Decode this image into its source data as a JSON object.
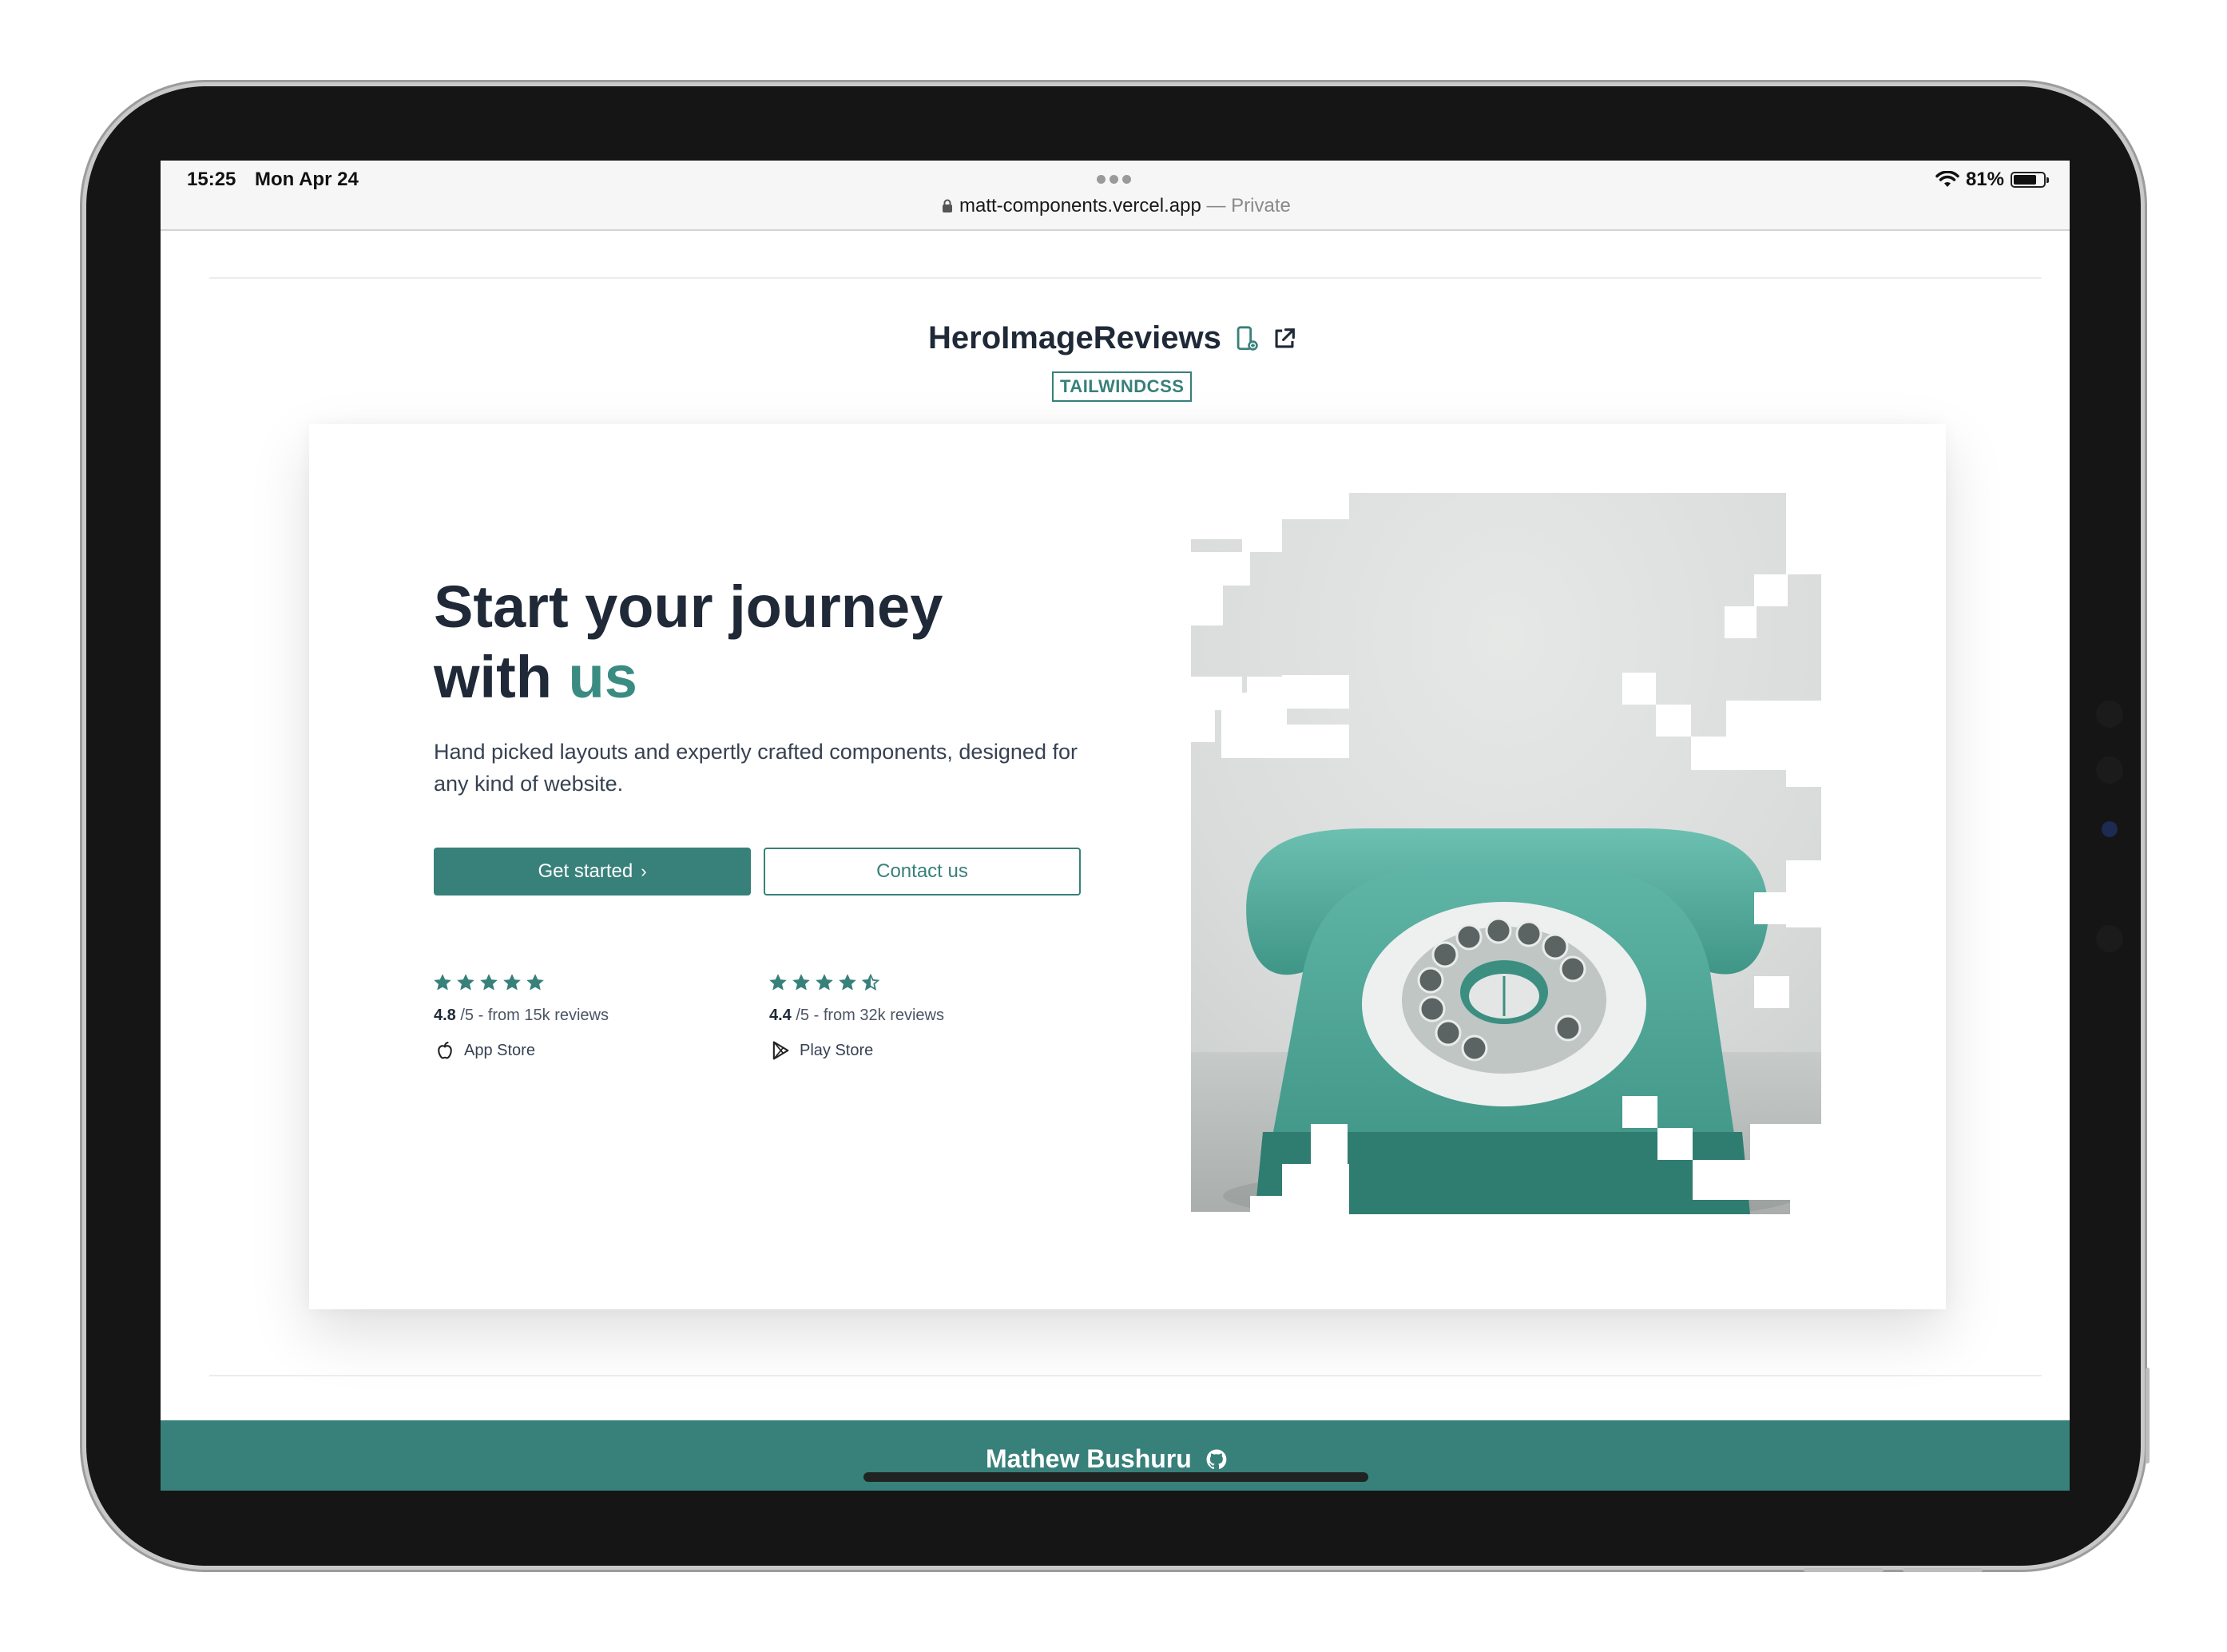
{
  "status_bar": {
    "time": "15:25",
    "date": "Mon Apr 24",
    "url": "matt-components.vercel.app",
    "private_label": "— Private",
    "battery": "81%",
    "battery_level": 0.81
  },
  "component": {
    "title": "HeroImageReviews",
    "badge": "TAILWINDCSS"
  },
  "hero": {
    "headline_part1": "Start your journey with ",
    "headline_accent": "us",
    "subtitle": "Hand picked layouts and expertly crafted components, designed for any kind of website.",
    "primary_button": "Get started",
    "secondary_button": "Contact us",
    "image_alt": "teal rotary telephone"
  },
  "reviews": [
    {
      "score": "4.8",
      "suffix": "/5 - from 15k reviews",
      "store": "App Store",
      "stars": 5,
      "icon": "apple-icon"
    },
    {
      "score": "4.4",
      "suffix": "/5 - from 32k reviews",
      "store": "Play Store",
      "stars": 4.5,
      "icon": "play-store-icon"
    }
  ],
  "footer": {
    "author": "Mathew Bushuru"
  },
  "colors": {
    "accent": "#38807a",
    "text_dark": "#1f2937",
    "footer_bg": "#38807a"
  }
}
